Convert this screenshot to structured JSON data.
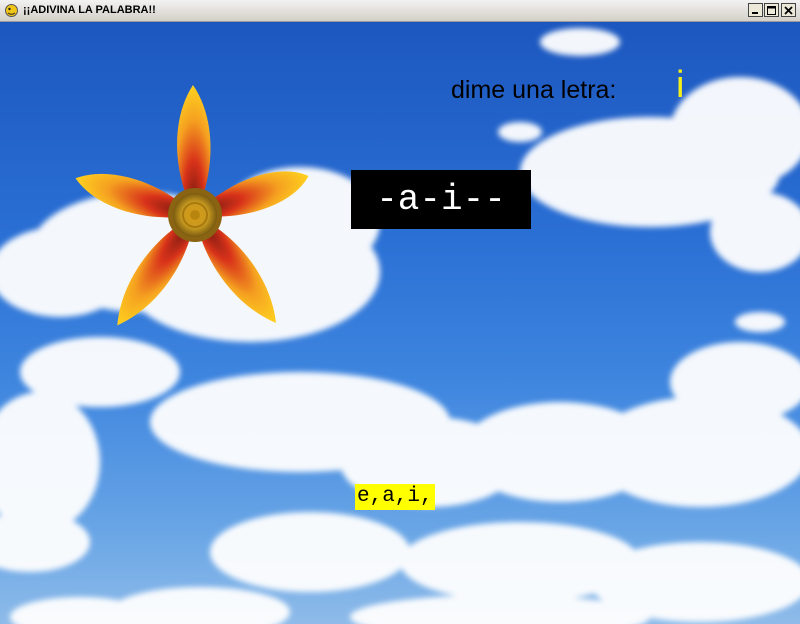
{
  "window": {
    "title": "¡¡ADIVINA LA PALABRA!!",
    "icon": "pygame-snake-icon",
    "controls": [
      "minimize",
      "maximize",
      "close"
    ]
  },
  "game": {
    "prompt": "dime una letra:",
    "current_input": "i",
    "hidden_word": "-a-i--",
    "guessed_letters": "e,a,i,"
  },
  "decorations": {
    "flower": "flower-image",
    "background": "sky-with-clouds"
  },
  "colors": {
    "input_letter": "#f4ef1a",
    "word_box_bg": "#000000",
    "word_box_text": "#ffffff",
    "guessed_bg": "#ffff00",
    "sky": "#2a6fd4"
  }
}
